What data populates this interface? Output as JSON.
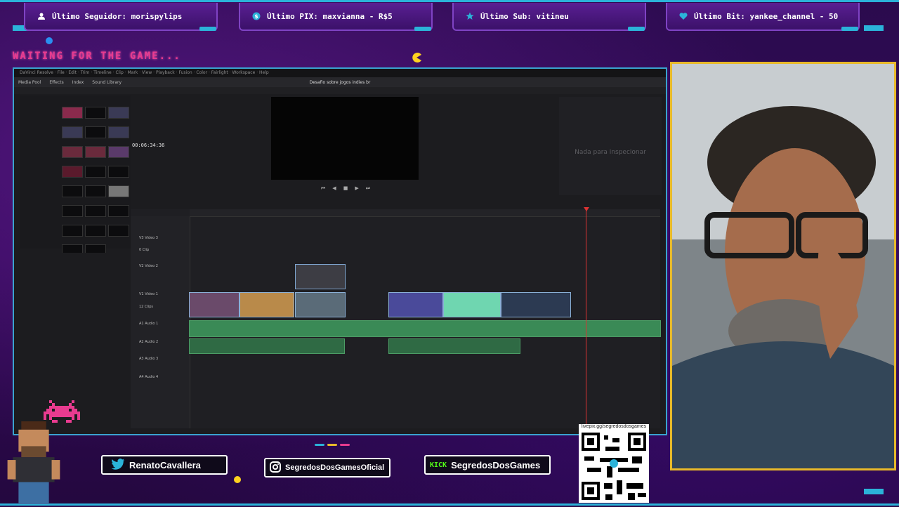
{
  "alerts": [
    {
      "label": "Último Seguidor: morispylips",
      "icon": "user-icon"
    },
    {
      "label": "Último PIX: maxvianna - R$5",
      "icon": "dollar-icon"
    },
    {
      "label": "Último Sub: vitineu",
      "icon": "star-icon"
    },
    {
      "label": "Último Bit: yankee_channel - 50",
      "icon": "heart-icon"
    }
  ],
  "overlay": {
    "waiting_text": "WAITING FOR THE GAME...",
    "accent_color": "#e83b8f",
    "frame_color": "#2bb3d9",
    "cam_border_color": "#e8b92a"
  },
  "editor": {
    "project_title": "Desafio sobre jogos indies br",
    "timecode": "00:06:34:36",
    "inspector_empty": "Nada para inspecionar",
    "toolbar": [
      "Media Pool",
      "Effects",
      "Index",
      "Sound Library"
    ],
    "tracks": [
      {
        "id": "V3",
        "name": "Video 3",
        "clips": "0 Clip"
      },
      {
        "id": "V2",
        "name": "Video 2",
        "clips": ""
      },
      {
        "id": "V1",
        "name": "Video 1",
        "clips": "12 Clips"
      },
      {
        "id": "A1",
        "name": "Audio 1",
        "clips": ""
      },
      {
        "id": "A2",
        "name": "Audio 2",
        "clips": ""
      },
      {
        "id": "A3",
        "name": "Audio 3",
        "clips": ""
      },
      {
        "id": "A4",
        "name": "Audio 4",
        "clips": ""
      }
    ]
  },
  "socials": [
    {
      "name": "RenatoCavallera",
      "icon": "twitter-icon"
    },
    {
      "name": "SegredosDosGamesOficial",
      "icon": "instagram-icon"
    },
    {
      "name": "SegredosDosGames",
      "icon": "kick-icon",
      "prefix": "KICK"
    }
  ],
  "qr": {
    "caption": "livepix.gg/segredosdosgames"
  }
}
